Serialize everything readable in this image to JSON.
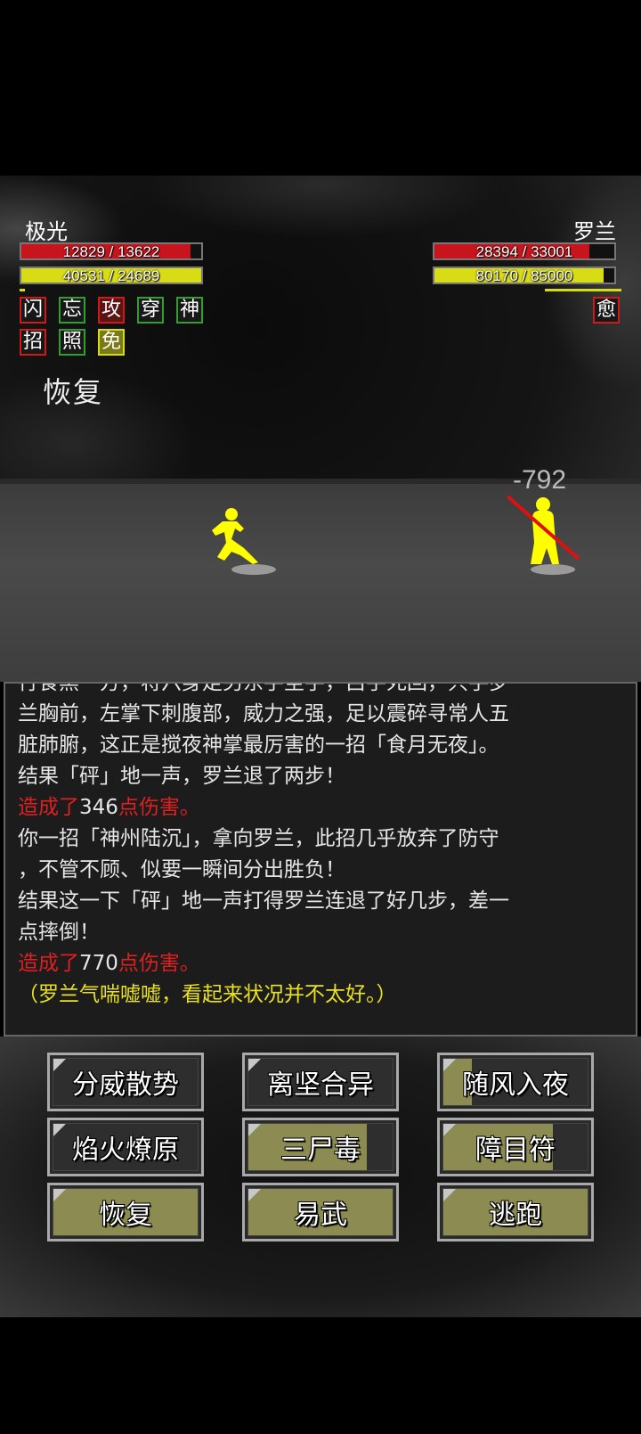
{
  "player": {
    "name": "极光",
    "hp_text": "12829 / 13622",
    "hp_fraction": 0.94,
    "mp_text": "40531 / 24689",
    "mp_fraction": 1.0,
    "status_icons": [
      {
        "char": "闪",
        "style": "red"
      },
      {
        "char": "忘",
        "style": "green"
      },
      {
        "char": "攻",
        "style": "darkred"
      },
      {
        "char": "穿",
        "style": "green"
      },
      {
        "char": "神",
        "style": "green"
      },
      {
        "char": "招",
        "style": "red"
      },
      {
        "char": "照",
        "style": "green"
      },
      {
        "char": "免",
        "style": "yellow"
      }
    ],
    "float_text": "恢复"
  },
  "enemy": {
    "name": "罗兰",
    "hp_text": "28394 / 33001",
    "hp_fraction": 0.86,
    "mp_text": "80170 / 85000",
    "mp_fraction": 0.94,
    "status_icons": [
      {
        "char": "愈",
        "style": "red"
      }
    ],
    "damage_float": "-792"
  },
  "log": {
    "cut_line": "行食黑一方，将六身走另东手至手，吕手死回，只手罗",
    "lines": [
      {
        "segments": [
          {
            "text": "兰胸前，左掌下刺腹部，威力之强，足以震碎寻常人五",
            "color": "white"
          }
        ]
      },
      {
        "segments": [
          {
            "text": "脏肺腑，这正是搅夜神掌最厉害的一招「食月无夜」。",
            "color": "white"
          }
        ]
      },
      {
        "segments": [
          {
            "text": "结果「砰」地一声，罗兰退了两步！",
            "color": "white"
          }
        ]
      },
      {
        "segments": [
          {
            "text": "造成了",
            "color": "red"
          },
          {
            "text": "346",
            "color": "white"
          },
          {
            "text": "点伤害。",
            "color": "red"
          }
        ]
      },
      {
        "segments": [
          {
            "text": "你一招「神州陆沉」，拿向罗兰，此招几乎放弃了防守",
            "color": "white"
          }
        ]
      },
      {
        "segments": [
          {
            "text": "，不管不顾、似要一瞬间分出胜负！",
            "color": "white"
          }
        ]
      },
      {
        "segments": [
          {
            "text": "结果这一下「砰」地一声打得罗兰连退了好几步，差一",
            "color": "white"
          }
        ]
      },
      {
        "segments": [
          {
            "text": "点摔倒！",
            "color": "white"
          }
        ]
      },
      {
        "segments": [
          {
            "text": "造成了",
            "color": "red"
          },
          {
            "text": "770",
            "color": "white"
          },
          {
            "text": "点伤害。",
            "color": "red"
          }
        ]
      },
      {
        "segments": [
          {
            "text": "（罗兰气喘嘘嘘，看起来状况并不太好。）",
            "color": "yellow"
          }
        ]
      }
    ]
  },
  "actions": [
    {
      "label": "分威散势",
      "cooldown_fraction": 0.0
    },
    {
      "label": "离坚合异",
      "cooldown_fraction": 0.0
    },
    {
      "label": "随风入夜",
      "cooldown_fraction": 0.2
    },
    {
      "label": "焰火燎原",
      "cooldown_fraction": 0.0
    },
    {
      "label": "三尸毒",
      "cooldown_fraction": 0.82
    },
    {
      "label": "障目符",
      "cooldown_fraction": 0.76
    },
    {
      "label": "恢复",
      "cooldown_fraction": 1.0
    },
    {
      "label": "易武",
      "cooldown_fraction": 1.0
    },
    {
      "label": "逃跑",
      "cooldown_fraction": 1.0
    }
  ],
  "colors": {
    "hp": "#c8141c",
    "mp": "#d8dc14",
    "fighter": "#ffff00",
    "staff": "#e01010"
  }
}
